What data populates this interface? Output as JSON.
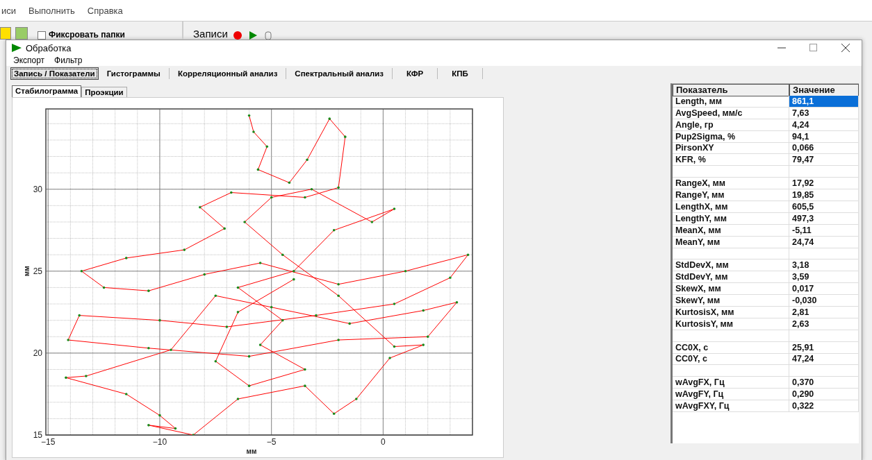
{
  "background_app": {
    "menu": [
      "иси",
      "Выполнить",
      "Справка"
    ],
    "toolbar": {
      "fix_folders": {
        "label": "Фиксровать папки",
        "checked": false
      },
      "records_label": "Записи"
    }
  },
  "window": {
    "title": "Обработка",
    "menu": [
      "Экспорт",
      "Фильтр"
    ],
    "tabs": [
      {
        "label": "Запись / Показатели",
        "selected": true
      },
      {
        "label": "Гистограммы",
        "selected": false
      },
      {
        "label": "Корреляционный анализ",
        "selected": false
      },
      {
        "label": "Спектральный анализ",
        "selected": false
      },
      {
        "label": "КФР",
        "selected": false
      },
      {
        "label": "КПБ",
        "selected": false
      }
    ],
    "subtabs": [
      {
        "label": "Стабилограмма",
        "selected": true
      },
      {
        "label": "Проэкции",
        "selected": false
      }
    ],
    "chart": {
      "chart_data": {
        "type": "line",
        "grid": true,
        "xlabel": "мм",
        "ylabel": "мм",
        "xlim": [
          -15.1,
          4.0
        ],
        "ylim": [
          15,
          34.9
        ],
        "xticks": [
          -15,
          -10,
          -5,
          0
        ],
        "yticks": [
          15,
          20,
          25,
          30
        ],
        "x": [
          -6,
          -5.8,
          -5.2,
          -5.6,
          -4.2,
          -3.4,
          -2.4,
          -1.7,
          -2.0,
          -3.5,
          -6.8,
          -8.2,
          -7.1,
          -8.9,
          -11.5,
          -13.5,
          -12.5,
          -10.5,
          -8.0,
          -5.5,
          -2.0,
          1.0,
          3.8,
          3.0,
          0.5,
          -3.0,
          -7.0,
          -10.0,
          -13.6,
          -14.1,
          -10.5,
          -6.0,
          -2.0,
          2.0,
          3.3,
          1.8,
          -1.5,
          -5.0,
          -7.5,
          -9.5,
          -13.3,
          -14.2,
          -11.5,
          -10.0,
          -9.3,
          -10.5,
          -8.5,
          -6.5,
          -3.5,
          -2.2,
          -1.2,
          0.3,
          1.8,
          0.5,
          -2.0,
          -4.5,
          -6.2,
          -5.0,
          -3.2,
          -0.5,
          0.5,
          -2.2,
          -4.0,
          -6.5,
          -4.5,
          -5.5,
          -3.5,
          -6.0,
          -7.5,
          -6.5,
          -4.0
        ],
        "series": [
          {
            "color": "#ff0000",
            "values": [
              34.5,
              33.5,
              32.6,
              31.2,
              30.4,
              31.8,
              34.3,
              33.2,
              30.1,
              29.5,
              29.8,
              28.9,
              27.6,
              26.3,
              25.8,
              25.0,
              24.0,
              23.8,
              24.8,
              25.5,
              24.2,
              25.0,
              26.0,
              24.6,
              23.0,
              22.3,
              21.6,
              22.0,
              22.3,
              20.8,
              20.3,
              19.8,
              20.8,
              21.0,
              23.1,
              22.6,
              21.8,
              22.8,
              23.5,
              20.2,
              18.6,
              18.5,
              17.5,
              16.2,
              15.4,
              15.6,
              15.0,
              17.2,
              18.0,
              16.3,
              17.2,
              19.7,
              20.5,
              20.4,
              23.5,
              26.0,
              28.0,
              29.5,
              30.0,
              28.0,
              28.8,
              27.5,
              25.0,
              24.0,
              22.0,
              20.5,
              19.0,
              18.0,
              19.5,
              22.5,
              24.5
            ]
          }
        ]
      }
    },
    "table": {
      "columns": [
        "Показатель",
        "Значение"
      ],
      "rows": [
        {
          "kind": "data",
          "name": "Length, мм",
          "value": "861,1",
          "selected": true
        },
        {
          "kind": "data",
          "name": "AvgSpeed, мм/с",
          "value": "7,63",
          "selected": false
        },
        {
          "kind": "data",
          "name": "Angle, гр",
          "value": "4,24",
          "selected": false
        },
        {
          "kind": "data",
          "name": "Pup2Sigma, %",
          "value": "94,1",
          "selected": false
        },
        {
          "kind": "data",
          "name": "PirsonXY",
          "value": "0,066",
          "selected": false
        },
        {
          "kind": "data",
          "name": "KFR, %",
          "value": "79,47",
          "selected": false
        },
        {
          "kind": "blank"
        },
        {
          "kind": "data",
          "name": "RangeX, мм",
          "value": "17,92",
          "selected": false
        },
        {
          "kind": "data",
          "name": "RangeY, мм",
          "value": "19,85",
          "selected": false
        },
        {
          "kind": "data",
          "name": "LengthX, мм",
          "value": "605,5",
          "selected": false
        },
        {
          "kind": "data",
          "name": "LengthY, мм",
          "value": "497,3",
          "selected": false
        },
        {
          "kind": "data",
          "name": "MeanX, мм",
          "value": "-5,11",
          "selected": false
        },
        {
          "kind": "data",
          "name": "MeanY, мм",
          "value": "24,74",
          "selected": false
        },
        {
          "kind": "blank"
        },
        {
          "kind": "data",
          "name": "StdDevX, мм",
          "value": "3,18",
          "selected": false
        },
        {
          "kind": "data",
          "name": "StdDevY, мм",
          "value": "3,59",
          "selected": false
        },
        {
          "kind": "data",
          "name": "SkewX, мм",
          "value": "0,017",
          "selected": false
        },
        {
          "kind": "data",
          "name": "SkewY, мм",
          "value": "-0,030",
          "selected": false
        },
        {
          "kind": "data",
          "name": "KurtosisX, мм",
          "value": "2,81",
          "selected": false
        },
        {
          "kind": "data",
          "name": "KurtosisY, мм",
          "value": "2,63",
          "selected": false
        },
        {
          "kind": "blank"
        },
        {
          "kind": "data",
          "name": "CC0X, с",
          "value": "25,91",
          "selected": false
        },
        {
          "kind": "data",
          "name": "CC0Y, с",
          "value": "47,24",
          "selected": false
        },
        {
          "kind": "blank"
        },
        {
          "kind": "data",
          "name": "wAvgFX, Гц",
          "value": "0,370",
          "selected": false
        },
        {
          "kind": "data",
          "name": "wAvgFY, Гц",
          "value": "0,290",
          "selected": false
        },
        {
          "kind": "data",
          "name": "wAvgFXY, Гц",
          "value": "0,322",
          "selected": false
        }
      ]
    }
  }
}
